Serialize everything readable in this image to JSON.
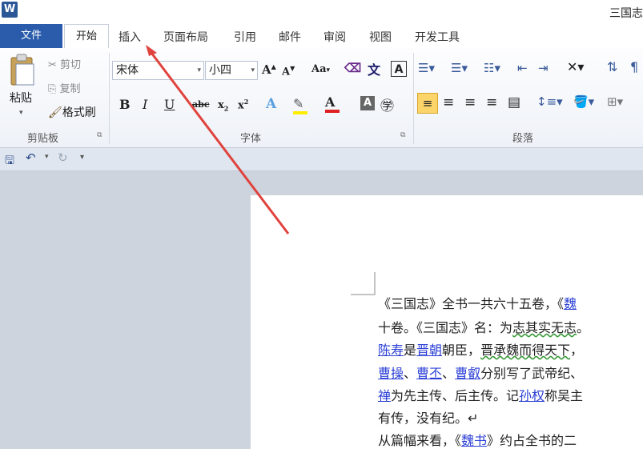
{
  "titlebar": {
    "app_icon": "W",
    "doc_title": "三国志"
  },
  "tabs": {
    "file": "文件",
    "home": "开始",
    "insert": "插入",
    "page_layout": "页面布局",
    "references": "引用",
    "mailings": "邮件",
    "review": "审阅",
    "view": "视图",
    "developer": "开发工具"
  },
  "clipboard": {
    "paste": "粘贴",
    "cut": "剪切",
    "copy": "复制",
    "format_painter": "格式刷",
    "label": "剪贴板"
  },
  "font": {
    "name": "宋体",
    "size": "小四",
    "label": "字体"
  },
  "paragraph": {
    "label": "段落"
  },
  "document": {
    "lines": [
      {
        "parts": [
          {
            "t": "《三国志》全书一共六十五卷，《"
          },
          {
            "t": "魏",
            "c": "lnk"
          }
        ]
      },
      {
        "parts": [
          {
            "t": "十卷。《三国志》名：为"
          },
          {
            "t": "志其实无志",
            "c": "green"
          },
          {
            "t": "。"
          }
        ]
      },
      {
        "parts": [
          {
            "t": "陈寿",
            "c": "lnk"
          },
          {
            "t": "是"
          },
          {
            "t": "晋朝",
            "c": "lnk"
          },
          {
            "t": "朝臣，"
          },
          {
            "t": "晋承魏而得天下",
            "c": "green"
          },
          {
            "t": "，"
          }
        ]
      },
      {
        "parts": [
          {
            "t": "曹操",
            "c": "lnk"
          },
          {
            "t": "、"
          },
          {
            "t": "曹丕",
            "c": "lnk"
          },
          {
            "t": "、"
          },
          {
            "t": "曹叡",
            "c": "lnk"
          },
          {
            "t": "分别写了武帝纪、"
          }
        ]
      },
      {
        "parts": [
          {
            "t": "禅",
            "c": "lnk"
          },
          {
            "t": "为先主传、后主传。记"
          },
          {
            "t": "孙权",
            "c": "lnk"
          },
          {
            "t": "称吴主"
          }
        ]
      },
      {
        "parts": [
          {
            "t": "有传，没有纪。↵"
          }
        ]
      },
      {
        "parts": [
          {
            "t": "从篇幅来看，《"
          },
          {
            "t": "魏书",
            "c": "lnk"
          },
          {
            "t": "》约占全书的二"
          }
        ]
      }
    ]
  },
  "colors": {
    "file_tab": "#2a5cab",
    "arrow": "#e0433d",
    "link": "#2b3fd6",
    "workspace": "#cdd4dd"
  }
}
